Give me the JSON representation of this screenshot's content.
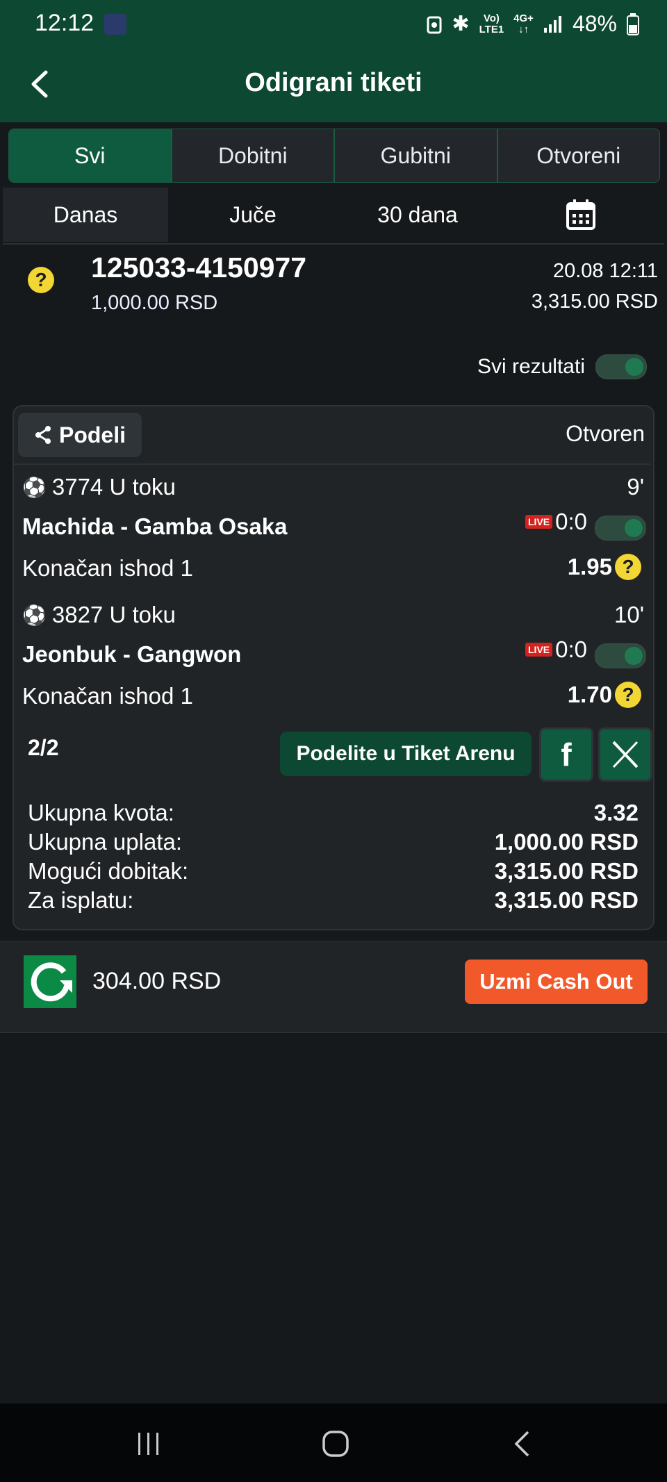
{
  "status_bar": {
    "time": "12:12",
    "network_top": "Vo)",
    "network_bottom": "LTE1",
    "data_top": "4G+",
    "data_bottom": "↓↑",
    "battery": "48%"
  },
  "header": {
    "title": "Odigrani tiketi"
  },
  "tabs": [
    {
      "label": "Svi"
    },
    {
      "label": "Dobitni"
    },
    {
      "label": "Gubitni"
    },
    {
      "label": "Otvoreni"
    }
  ],
  "periods": [
    {
      "label": "Danas"
    },
    {
      "label": "Juče"
    },
    {
      "label": "30 dana"
    }
  ],
  "ticket": {
    "id": "125033-4150977",
    "stake": "1,000.00 RSD",
    "datetime": "20.08 12:11",
    "potential": "3,315.00 RSD",
    "all_results_label": "Svi rezultati",
    "share_label": "Podeli",
    "status": "Otvoren",
    "events": [
      {
        "header": "3774 U toku",
        "minute": "9'",
        "match": "Machida - Gamba Osaka",
        "live": "LIVE",
        "score": "0:0",
        "market": "Konačan ishod 1",
        "odd": "1.95"
      },
      {
        "header": "3827 U toku",
        "minute": "10'",
        "match": "Jeonbuk - Gangwon",
        "live": "LIVE",
        "score": "0:0",
        "market": "Konačan ishod 1",
        "odd": "1.70"
      }
    ],
    "count": "2/2",
    "arena_label": "Podelite u Tiket Arenu",
    "summary": [
      {
        "label": "Ukupna kvota:",
        "value": "3.32"
      },
      {
        "label": "Ukupna uplata:",
        "value": "1,000.00 RSD"
      },
      {
        "label": "Mogući dobitak:",
        "value": "3,315.00 RSD"
      },
      {
        "label": "Za isplatu:",
        "value": "3,315.00 RSD"
      }
    ]
  },
  "cashout": {
    "amount": "304.00 RSD",
    "button_label": "Uzmi Cash Out"
  },
  "colors": {
    "header": "#0c4832",
    "active_tab": "#0f5b3f",
    "cashout_button": "#f1592a",
    "live_badge": "#d4231f",
    "help_icon": "#f2d633"
  }
}
